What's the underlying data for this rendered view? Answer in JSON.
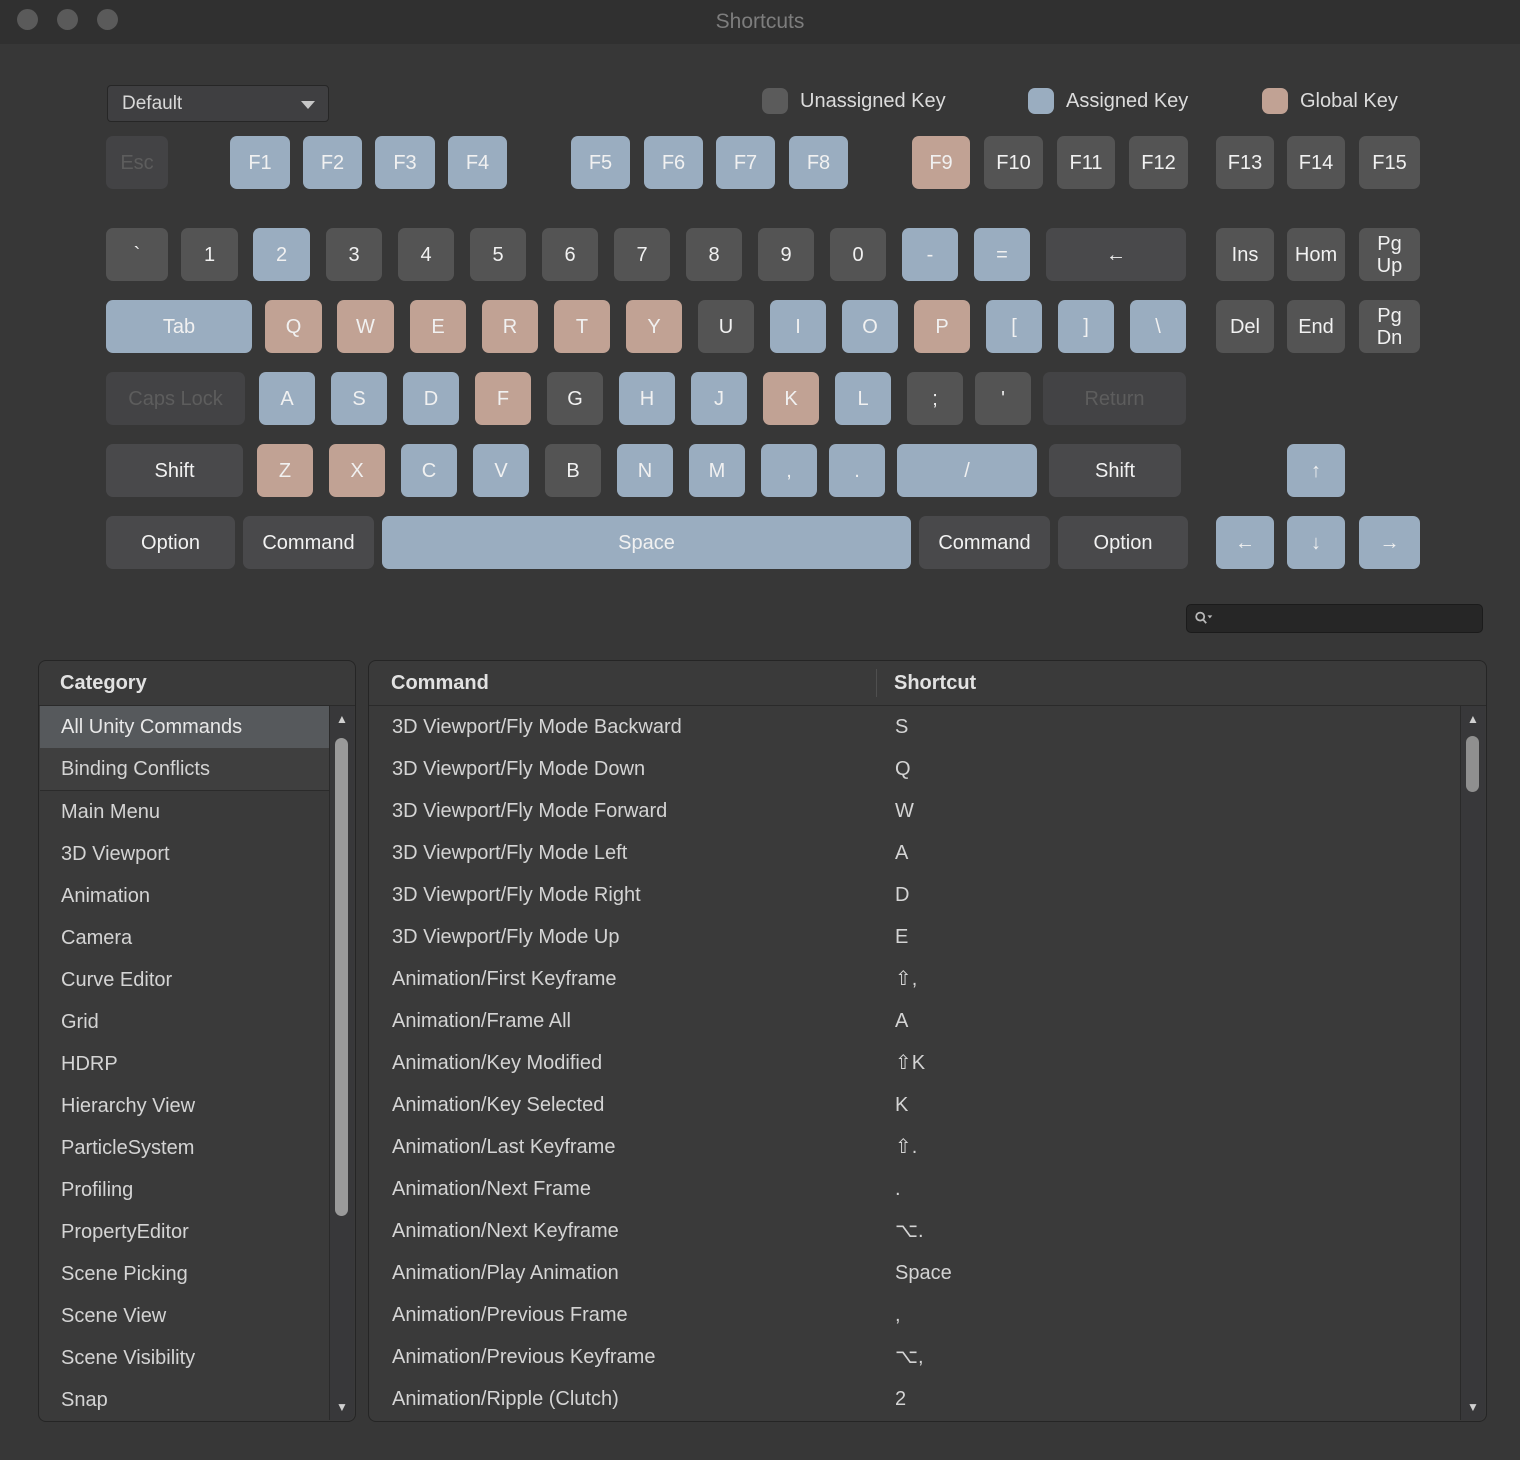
{
  "window": {
    "title": "Shortcuts"
  },
  "toolbar": {
    "profile_dropdown": {
      "value": "Default"
    },
    "legend": [
      {
        "label": "Unassigned Key",
        "color": "#5b5b5b"
      },
      {
        "label": "Assigned Key",
        "color": "#9aadc0"
      },
      {
        "label": "Global Key",
        "color": "#c1a294"
      }
    ]
  },
  "search": {
    "value": "",
    "icon": "magnifier-filter-icon"
  },
  "key_colors": {
    "unassigned": "#545454",
    "assigned": "#9aadc0",
    "global": "#c1a294",
    "modifier": "#49494b",
    "disabled": "#434345"
  },
  "keyboard": {
    "rows": [
      [
        {
          "id": "esc",
          "label": "Esc",
          "state": "disabled"
        },
        {
          "id": "f1",
          "label": "F1",
          "state": "assigned"
        },
        {
          "id": "f2",
          "label": "F2",
          "state": "assigned"
        },
        {
          "id": "f3",
          "label": "F3",
          "state": "assigned"
        },
        {
          "id": "f4",
          "label": "F4",
          "state": "assigned"
        },
        {
          "id": "f5",
          "label": "F5",
          "state": "assigned"
        },
        {
          "id": "f6",
          "label": "F6",
          "state": "assigned"
        },
        {
          "id": "f7",
          "label": "F7",
          "state": "assigned"
        },
        {
          "id": "f8",
          "label": "F8",
          "state": "assigned"
        },
        {
          "id": "f9",
          "label": "F9",
          "state": "global"
        },
        {
          "id": "f10",
          "label": "F10",
          "state": "unassigned"
        },
        {
          "id": "f11",
          "label": "F11",
          "state": "unassigned"
        },
        {
          "id": "f12",
          "label": "F12",
          "state": "unassigned"
        },
        {
          "id": "f13",
          "label": "F13",
          "state": "unassigned"
        },
        {
          "id": "f14",
          "label": "F14",
          "state": "unassigned"
        },
        {
          "id": "f15",
          "label": "F15",
          "state": "unassigned"
        }
      ],
      [
        {
          "id": "backtick",
          "label": "`",
          "state": "unassigned"
        },
        {
          "id": "digit-1",
          "label": "1",
          "state": "unassigned"
        },
        {
          "id": "digit-2",
          "label": "2",
          "state": "assigned"
        },
        {
          "id": "digit-3",
          "label": "3",
          "state": "unassigned"
        },
        {
          "id": "digit-4",
          "label": "4",
          "state": "unassigned"
        },
        {
          "id": "digit-5",
          "label": "5",
          "state": "unassigned"
        },
        {
          "id": "digit-6",
          "label": "6",
          "state": "unassigned"
        },
        {
          "id": "digit-7",
          "label": "7",
          "state": "unassigned"
        },
        {
          "id": "digit-8",
          "label": "8",
          "state": "unassigned"
        },
        {
          "id": "digit-9",
          "label": "9",
          "state": "unassigned"
        },
        {
          "id": "digit-0",
          "label": "0",
          "state": "unassigned"
        },
        {
          "id": "minus",
          "label": "-",
          "state": "assigned"
        },
        {
          "id": "equals",
          "label": "=",
          "state": "assigned"
        },
        {
          "id": "backspace",
          "label": "←",
          "state": "modifier"
        }
      ],
      [
        {
          "id": "tab",
          "label": "Tab",
          "state": "assigned"
        },
        {
          "id": "q",
          "label": "Q",
          "state": "global"
        },
        {
          "id": "w",
          "label": "W",
          "state": "global"
        },
        {
          "id": "e",
          "label": "E",
          "state": "global"
        },
        {
          "id": "r",
          "label": "R",
          "state": "global"
        },
        {
          "id": "t",
          "label": "T",
          "state": "global"
        },
        {
          "id": "y",
          "label": "Y",
          "state": "global"
        },
        {
          "id": "u",
          "label": "U",
          "state": "unassigned"
        },
        {
          "id": "i",
          "label": "I",
          "state": "assigned"
        },
        {
          "id": "o",
          "label": "O",
          "state": "assigned"
        },
        {
          "id": "p",
          "label": "P",
          "state": "global"
        },
        {
          "id": "bracket-left",
          "label": "[",
          "state": "assigned"
        },
        {
          "id": "bracket-right",
          "label": "]",
          "state": "assigned"
        },
        {
          "id": "backslash",
          "label": "\\",
          "state": "assigned"
        }
      ],
      [
        {
          "id": "caps-lock",
          "label": "Caps Lock",
          "state": "disabled"
        },
        {
          "id": "a",
          "label": "A",
          "state": "assigned"
        },
        {
          "id": "s",
          "label": "S",
          "state": "assigned"
        },
        {
          "id": "d",
          "label": "D",
          "state": "assigned"
        },
        {
          "id": "f",
          "label": "F",
          "state": "global"
        },
        {
          "id": "g",
          "label": "G",
          "state": "unassigned"
        },
        {
          "id": "h",
          "label": "H",
          "state": "assigned"
        },
        {
          "id": "j",
          "label": "J",
          "state": "assigned"
        },
        {
          "id": "k",
          "label": "K",
          "state": "global"
        },
        {
          "id": "l",
          "label": "L",
          "state": "assigned"
        },
        {
          "id": "semicolon",
          "label": ";",
          "state": "unassigned"
        },
        {
          "id": "quote",
          "label": "'",
          "state": "unassigned"
        },
        {
          "id": "return",
          "label": "Return",
          "state": "disabled"
        }
      ],
      [
        {
          "id": "shift-left",
          "label": "Shift",
          "state": "modifier"
        },
        {
          "id": "z",
          "label": "Z",
          "state": "global"
        },
        {
          "id": "x",
          "label": "X",
          "state": "global"
        },
        {
          "id": "c",
          "label": "C",
          "state": "assigned"
        },
        {
          "id": "v",
          "label": "V",
          "state": "assigned"
        },
        {
          "id": "b",
          "label": "B",
          "state": "unassigned"
        },
        {
          "id": "n",
          "label": "N",
          "state": "assigned"
        },
        {
          "id": "m",
          "label": "M",
          "state": "assigned"
        },
        {
          "id": "comma",
          "label": ",",
          "state": "assigned"
        },
        {
          "id": "period",
          "label": ".",
          "state": "assigned"
        },
        {
          "id": "slash",
          "label": "/",
          "state": "assigned"
        },
        {
          "id": "shift-right",
          "label": "Shift",
          "state": "modifier"
        }
      ],
      [
        {
          "id": "option-left",
          "label": "Option",
          "state": "modifier"
        },
        {
          "id": "command-left",
          "label": "Command",
          "state": "modifier"
        },
        {
          "id": "space",
          "label": "Space",
          "state": "assigned"
        },
        {
          "id": "command-right",
          "label": "Command",
          "state": "modifier"
        },
        {
          "id": "option-right",
          "label": "Option",
          "state": "modifier"
        }
      ]
    ],
    "side_keys": [
      {
        "id": "ins",
        "label": "Ins",
        "state": "unassigned"
      },
      {
        "id": "hom",
        "label": "Hom",
        "state": "unassigned"
      },
      {
        "id": "pgup",
        "label": "Pg\nUp",
        "state": "unassigned"
      },
      {
        "id": "del",
        "label": "Del",
        "state": "unassigned"
      },
      {
        "id": "end",
        "label": "End",
        "state": "unassigned"
      },
      {
        "id": "pgdn",
        "label": "Pg\nDn",
        "state": "unassigned"
      },
      {
        "id": "arrow-up",
        "label": "↑",
        "state": "assigned"
      },
      {
        "id": "arrow-left",
        "label": "←",
        "state": "assigned"
      },
      {
        "id": "arrow-down",
        "label": "↓",
        "state": "assigned"
      },
      {
        "id": "arrow-right",
        "label": "→",
        "state": "assigned"
      }
    ]
  },
  "category_panel": {
    "header": "Category",
    "selected": "All Unity Commands",
    "pinned": [
      "All Unity Commands",
      "Binding Conflicts"
    ],
    "groups": [
      "Main Menu",
      "3D Viewport",
      "Animation",
      "Camera",
      "Curve Editor",
      "Grid",
      "HDRP",
      "Hierarchy View",
      "ParticleSystem",
      "Profiling",
      "PropertyEditor",
      "Scene Picking",
      "Scene View",
      "Scene Visibility",
      "Snap"
    ]
  },
  "command_table": {
    "headers": [
      "Command",
      "Shortcut"
    ],
    "rows": [
      {
        "command": "3D Viewport/Fly Mode Backward",
        "shortcut": "S"
      },
      {
        "command": "3D Viewport/Fly Mode Down",
        "shortcut": "Q"
      },
      {
        "command": "3D Viewport/Fly Mode Forward",
        "shortcut": "W"
      },
      {
        "command": "3D Viewport/Fly Mode Left",
        "shortcut": "A"
      },
      {
        "command": "3D Viewport/Fly Mode Right",
        "shortcut": "D"
      },
      {
        "command": "3D Viewport/Fly Mode Up",
        "shortcut": "E"
      },
      {
        "command": "Animation/First Keyframe",
        "shortcut": "⇧,"
      },
      {
        "command": "Animation/Frame All",
        "shortcut": "A"
      },
      {
        "command": "Animation/Key Modified",
        "shortcut": "⇧K"
      },
      {
        "command": "Animation/Key Selected",
        "shortcut": "K"
      },
      {
        "command": "Animation/Last Keyframe",
        "shortcut": "⇧."
      },
      {
        "command": "Animation/Next Frame",
        "shortcut": "."
      },
      {
        "command": "Animation/Next Keyframe",
        "shortcut": "⌥."
      },
      {
        "command": "Animation/Play Animation",
        "shortcut": "Space"
      },
      {
        "command": "Animation/Previous Frame",
        "shortcut": ","
      },
      {
        "command": "Animation/Previous Keyframe",
        "shortcut": "⌥,"
      },
      {
        "command": "Animation/Ripple (Clutch)",
        "shortcut": "2"
      }
    ]
  }
}
